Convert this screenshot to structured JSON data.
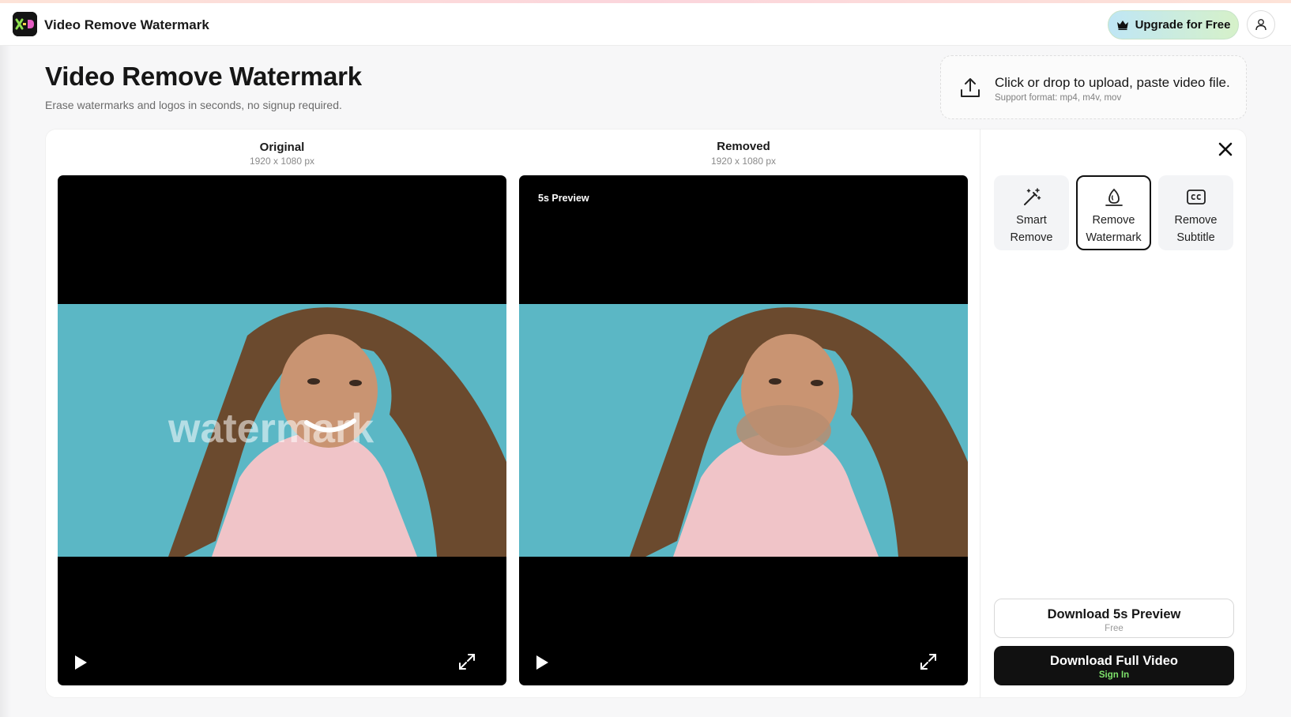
{
  "header": {
    "app_title": "Video Remove Watermark",
    "upgrade_label": "Upgrade for Free",
    "logo_icon": "xd-logo-icon",
    "user_icon": "user-icon"
  },
  "hero": {
    "title": "Video Remove Watermark",
    "subtitle": "Erase watermarks and logos in seconds, no signup required."
  },
  "upload": {
    "main_text": "Click or drop to upload, paste video file.",
    "formats": "Support format: mp4, m4v, mov",
    "icon": "upload-icon"
  },
  "comparison": {
    "original": {
      "label": "Original",
      "resolution": "1920 x 1080 px",
      "watermark_text": "watermark"
    },
    "removed": {
      "label": "Removed",
      "resolution": "1920 x 1080 px",
      "badge": "5s Preview"
    }
  },
  "tools": {
    "items": [
      {
        "line1": "Smart",
        "line2": "Remove",
        "icon": "magic-wand-icon",
        "active": false
      },
      {
        "line1": "Remove",
        "line2": "Watermark",
        "icon": "eraser-icon",
        "active": true
      },
      {
        "line1": "Remove",
        "line2": "Subtitle",
        "icon": "cc-icon",
        "active": false
      }
    ]
  },
  "actions": {
    "preview_label": "Download 5s Preview",
    "preview_sub": "Free",
    "full_label": "Download Full Video",
    "full_sub": "Sign In"
  },
  "colors": {
    "accent_green": "#7ee36b",
    "frame_teal": "#5bb7c5",
    "primary_dark": "#111111"
  }
}
